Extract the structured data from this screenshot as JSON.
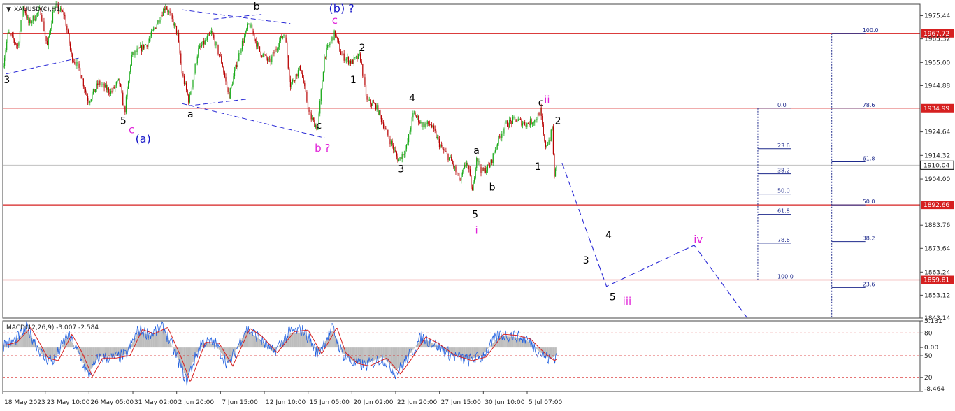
{
  "chart_data": {
    "type": "line",
    "title": "XAUUSD(€),H1",
    "panes": {
      "price": {
        "ylim": [
          1843.14,
          1980.5
        ]
      },
      "macd": {
        "title": "MACD(12,26,9) -3.007 -2.584",
        "ylim": [
          -8.464,
          5.131
        ]
      }
    },
    "y_ticks": [
      {
        "label": "1975.44",
        "value": 1975.44
      },
      {
        "label": "1965.32",
        "value": 1965.32
      },
      {
        "label": "1955.00",
        "value": 1955.0
      },
      {
        "label": "1944.88",
        "value": 1944.88
      },
      {
        "label": "1924.64",
        "value": 1924.64
      },
      {
        "label": "1914.32",
        "value": 1914.32
      },
      {
        "label": "1904.00",
        "value": 1904.0
      },
      {
        "label": "1883.76",
        "value": 1883.76
      },
      {
        "label": "1873.64",
        "value": 1873.64
      },
      {
        "label": "1863.24",
        "value": 1863.24
      },
      {
        "label": "1853.12",
        "value": 1853.12
      },
      {
        "label": "1843.14",
        "value": 1843.14
      }
    ],
    "macd_ticks": [
      {
        "label": "5.131",
        "value": 5.131
      },
      {
        "label": "80",
        "value": 2.8
      },
      {
        "label": "0.00",
        "value": 0.0
      },
      {
        "label": "50",
        "value": -1.6
      },
      {
        "label": "20",
        "value": -5.8
      },
      {
        "label": "-8.464",
        "value": -8.464
      }
    ],
    "x_ticks": [
      {
        "label": "18 May 2023",
        "t": 0
      },
      {
        "label": "23 May 10:00",
        "t": 62
      },
      {
        "label": "26 May 05:00",
        "t": 126
      },
      {
        "label": "31 May 02:00",
        "t": 190
      },
      {
        "label": "2 Jun 20:00",
        "t": 254
      },
      {
        "label": "7 Jun 15:00",
        "t": 318
      },
      {
        "label": "12 Jun 10:00",
        "t": 382
      },
      {
        "label": "15 Jun 05:00",
        "t": 446
      },
      {
        "label": "20 Jun 02:00",
        "t": 510
      },
      {
        "label": "22 Jun 20:00",
        "t": 574
      },
      {
        "label": "27 Jun 15:00",
        "t": 638
      },
      {
        "label": "30 Jun 10:00",
        "t": 702
      },
      {
        "label": "5 Jul 07:00",
        "t": 766
      }
    ],
    "t_range": [
      0,
      1340
    ],
    "horizontal_levels": [
      {
        "label": "1967.72",
        "value": 1967.72,
        "color": "#d62020"
      },
      {
        "label": "1934.99",
        "value": 1934.99,
        "color": "#d62020"
      },
      {
        "label": "1892.66",
        "value": 1892.66,
        "color": "#d62020"
      },
      {
        "label": "1859.81",
        "value": 1859.81,
        "color": "#d62020"
      }
    ],
    "current_price": {
      "label": "1910.04",
      "value": 1910.04
    },
    "price_anchors": [
      [
        0,
        1953
      ],
      [
        8,
        1968
      ],
      [
        22,
        1962
      ],
      [
        30,
        1980
      ],
      [
        38,
        1972
      ],
      [
        55,
        1978
      ],
      [
        65,
        1962
      ],
      [
        75,
        1980
      ],
      [
        90,
        1976
      ],
      [
        100,
        1958
      ],
      [
        112,
        1952
      ],
      [
        125,
        1938
      ],
      [
        140,
        1946
      ],
      [
        158,
        1942
      ],
      [
        170,
        1947
      ],
      [
        178,
        1933
      ],
      [
        188,
        1958
      ],
      [
        210,
        1963
      ],
      [
        225,
        1972
      ],
      [
        238,
        1980
      ],
      [
        255,
        1968
      ],
      [
        262,
        1950
      ],
      [
        272,
        1938
      ],
      [
        285,
        1960
      ],
      [
        305,
        1968
      ],
      [
        320,
        1955
      ],
      [
        330,
        1940
      ],
      [
        348,
        1962
      ],
      [
        360,
        1972
      ],
      [
        375,
        1960
      ],
      [
        390,
        1955
      ],
      [
        405,
        1965
      ],
      [
        412,
        1968
      ],
      [
        420,
        1945
      ],
      [
        435,
        1953
      ],
      [
        448,
        1932
      ],
      [
        460,
        1926
      ],
      [
        470,
        1958
      ],
      [
        485,
        1968
      ],
      [
        495,
        1958
      ],
      [
        510,
        1955
      ],
      [
        522,
        1958
      ],
      [
        532,
        1938
      ],
      [
        545,
        1936
      ],
      [
        560,
        1925
      ],
      [
        578,
        1912
      ],
      [
        590,
        1918
      ],
      [
        600,
        1933
      ],
      [
        612,
        1928
      ],
      [
        625,
        1928
      ],
      [
        640,
        1918
      ],
      [
        655,
        1912
      ],
      [
        668,
        1903
      ],
      [
        678,
        1912
      ],
      [
        686,
        1898
      ],
      [
        692,
        1914
      ],
      [
        700,
        1907
      ],
      [
        712,
        1910
      ],
      [
        722,
        1920
      ],
      [
        735,
        1928
      ],
      [
        750,
        1930
      ],
      [
        765,
        1928
      ],
      [
        778,
        1930
      ],
      [
        785,
        1934
      ],
      [
        792,
        1918
      ],
      [
        800,
        1922
      ],
      [
        803,
        1928
      ],
      [
        805,
        1905
      ],
      [
        810,
        1910
      ]
    ],
    "macd_anchors": [
      [
        0,
        0.5
      ],
      [
        15,
        1
      ],
      [
        35,
        3.8
      ],
      [
        60,
        -2
      ],
      [
        75,
        -2.5
      ],
      [
        95,
        2.5
      ],
      [
        110,
        -1
      ],
      [
        125,
        -5.5
      ],
      [
        140,
        -2
      ],
      [
        160,
        -2
      ],
      [
        180,
        -1.5
      ],
      [
        198,
        3.4
      ],
      [
        215,
        2.6
      ],
      [
        235,
        3.8
      ],
      [
        255,
        -2
      ],
      [
        268,
        -6.5
      ],
      [
        290,
        1
      ],
      [
        310,
        0.8
      ],
      [
        330,
        -3.5
      ],
      [
        355,
        3.6
      ],
      [
        372,
        2.2
      ],
      [
        395,
        -1
      ],
      [
        420,
        3
      ],
      [
        440,
        3.3
      ],
      [
        460,
        -1.2
      ],
      [
        482,
        3.8
      ],
      [
        495,
        -1
      ],
      [
        512,
        -3
      ],
      [
        530,
        -3.5
      ],
      [
        555,
        -2
      ],
      [
        575,
        -5
      ],
      [
        592,
        -2
      ],
      [
        612,
        2
      ],
      [
        630,
        0.8
      ],
      [
        655,
        -1.5
      ],
      [
        680,
        -2.5
      ],
      [
        700,
        -1.8
      ],
      [
        725,
        2.5
      ],
      [
        745,
        2.3
      ],
      [
        765,
        1.6
      ],
      [
        785,
        -1
      ],
      [
        800,
        -2.5
      ],
      [
        810,
        -1.5
      ]
    ],
    "wave_labels": [
      {
        "text": "3",
        "t": 6,
        "price": 1946,
        "color": "#000000",
        "size": 14
      },
      {
        "text": "b",
        "t": 371,
        "price": 1978,
        "color": "#000000",
        "size": 14
      },
      {
        "text": "(b) ?",
        "t": 495,
        "price": 1977,
        "color": "#1414c8",
        "size": 16
      },
      {
        "text": "c",
        "t": 485,
        "price": 1972,
        "color": "#e020d8",
        "size": 15
      },
      {
        "text": "2",
        "t": 525,
        "price": 1960,
        "color": "#000000",
        "size": 14
      },
      {
        "text": "1",
        "t": 512,
        "price": 1946,
        "color": "#000000",
        "size": 14
      },
      {
        "text": "4",
        "t": 598,
        "price": 1938,
        "color": "#000000",
        "size": 14
      },
      {
        "text": "c",
        "t": 786,
        "price": 1936,
        "color": "#000000",
        "size": 14
      },
      {
        "text": "ii",
        "t": 795,
        "price": 1937,
        "color": "#e020d8",
        "size": 15
      },
      {
        "text": "2",
        "t": 811,
        "price": 1928,
        "color": "#000000",
        "size": 14
      },
      {
        "text": "5",
        "t": 176,
        "price": 1928,
        "color": "#000000",
        "size": 14
      },
      {
        "text": "c",
        "t": 188,
        "price": 1924,
        "color": "#e020d8",
        "size": 15
      },
      {
        "text": "(a)",
        "t": 205,
        "price": 1920,
        "color": "#1414c8",
        "size": 16
      },
      {
        "text": "a",
        "t": 274,
        "price": 1931,
        "color": "#000000",
        "size": 14
      },
      {
        "text": "c",
        "t": 462,
        "price": 1926,
        "color": "#000000",
        "size": 14
      },
      {
        "text": "b ?",
        "t": 467,
        "price": 1916,
        "color": "#e020d8",
        "size": 15
      },
      {
        "text": "3",
        "t": 582,
        "price": 1907,
        "color": "#000000",
        "size": 14
      },
      {
        "text": "a",
        "t": 692,
        "price": 1915,
        "color": "#000000",
        "size": 14
      },
      {
        "text": "1",
        "t": 782,
        "price": 1908,
        "color": "#000000",
        "size": 14
      },
      {
        "text": "b",
        "t": 715,
        "price": 1899,
        "color": "#000000",
        "size": 14
      },
      {
        "text": "5",
        "t": 690,
        "price": 1887,
        "color": "#000000",
        "size": 14
      },
      {
        "text": "i",
        "t": 692,
        "price": 1880,
        "color": "#e020d8",
        "size": 15
      },
      {
        "text": "4",
        "t": 885,
        "price": 1878,
        "color": "#000000",
        "size": 14
      },
      {
        "text": "iv",
        "t": 1016,
        "price": 1876,
        "color": "#e020d8",
        "size": 15
      },
      {
        "text": "3",
        "t": 852,
        "price": 1867,
        "color": "#000000",
        "size": 14
      },
      {
        "text": "5",
        "t": 891,
        "price": 1851,
        "color": "#000000",
        "size": 14
      },
      {
        "text": "iii",
        "t": 912,
        "price": 1849,
        "color": "#e020d8",
        "size": 15
      }
    ],
    "projection": [
      [
        817,
        1911
      ],
      [
        882,
        1857
      ],
      [
        1010,
        1875
      ],
      [
        1088,
        1843
      ]
    ],
    "channels": [
      [
        [
          5,
          1950
        ],
        [
          112,
          1957
        ]
      ],
      [
        [
          262,
          1978
        ],
        [
          420,
          1972
        ]
      ],
      [
        [
          308,
          1974
        ],
        [
          378,
          1976
        ]
      ],
      [
        [
          262,
          1937
        ],
        [
          470,
          1922
        ]
      ],
      [
        [
          270,
          1936
        ],
        [
          358,
          1939
        ]
      ]
    ],
    "fib_left": {
      "t": 1103,
      "top": 1934.99,
      "bottom": 1859.81,
      "levels": [
        {
          "label": "0.0",
          "value": 1934.99
        },
        {
          "label": "23.6",
          "value": 1917.25
        },
        {
          "label": "38.2",
          "value": 1906.27
        },
        {
          "label": "50.0",
          "value": 1897.4
        },
        {
          "label": "61.8",
          "value": 1888.53
        },
        {
          "label": "78.6",
          "value": 1875.9
        },
        {
          "label": "100.0",
          "value": 1859.81
        }
      ]
    },
    "fib_right": {
      "t": 1211,
      "top": 1967.72,
      "bottom": 1843.14,
      "levels": [
        {
          "label": "100.0",
          "value": 1967.72
        },
        {
          "label": "78.6",
          "value": 1934.99
        },
        {
          "label": "61.8",
          "value": 1911.5
        },
        {
          "label": "50.0",
          "value": 1892.66
        },
        {
          "label": "38.2",
          "value": 1876.6
        },
        {
          "label": "23.6",
          "value": 1856.5
        }
      ]
    }
  }
}
